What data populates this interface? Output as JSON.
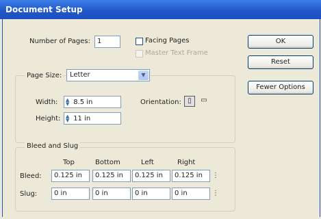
{
  "window": {
    "title": "Document Setup"
  },
  "pages": {
    "label": "Number of Pages:",
    "value": "1",
    "facing_pages_label": "Facing Pages",
    "facing_pages_checked": false,
    "master_text_frame_label": "Master Text Frame",
    "master_text_frame_checked": false,
    "master_text_frame_enabled": false
  },
  "buttons": {
    "ok": "OK",
    "reset": "Reset",
    "fewer_options": "Fewer Options"
  },
  "page_size": {
    "label": "Page Size:",
    "selected": "Letter",
    "width_label": "Width:",
    "width_value": "8.5 in",
    "height_label": "Height:",
    "height_value": "11 in",
    "orientation_label": "Orientation:",
    "orientation_selected": "portrait"
  },
  "bleed_slug": {
    "legend": "Bleed and Slug",
    "columns": [
      "Top",
      "Bottom",
      "Left",
      "Right"
    ],
    "bleed_label": "Bleed:",
    "bleed_values": [
      "0.125 in",
      "0.125 in",
      "0.125 in",
      "0.125 in"
    ],
    "slug_label": "Slug:",
    "slug_values": [
      "0 in",
      "0 in",
      "0 in",
      "0 in"
    ]
  },
  "icons": {
    "spinner": "spinner-icon",
    "portrait": "portrait-orientation-icon",
    "landscape": "landscape-orientation-icon",
    "chain": "chain-link-icon",
    "dropdown": "chevron-down-icon"
  },
  "colors": {
    "titlebar": "#2158c9",
    "dialog_bg": "#ece9d8",
    "field_border": "#7f9db9"
  }
}
